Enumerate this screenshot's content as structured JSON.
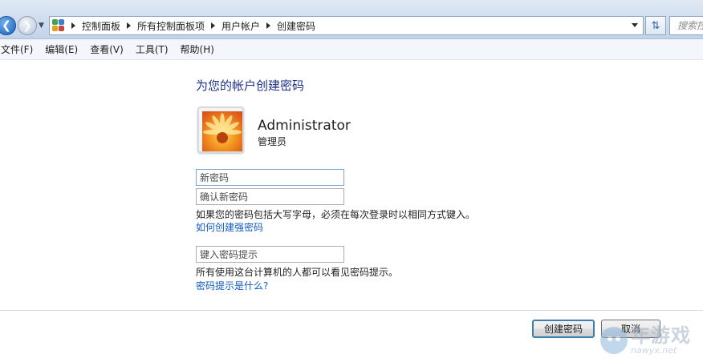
{
  "address_bar": {
    "breadcrumbs": [
      "控制面板",
      "所有控制面板项",
      "用户帐户",
      "创建密码"
    ],
    "search_placeholder": "搜索控"
  },
  "menu": {
    "items": [
      "文件(F)",
      "编辑(E)",
      "查看(V)",
      "工具(T)",
      "帮助(H)"
    ]
  },
  "main": {
    "title": "为您的帐户创建密码",
    "user": {
      "name": "Administrator",
      "role": "管理员"
    },
    "fields": {
      "new_password_placeholder": "新密码",
      "confirm_password_placeholder": "确认新密码",
      "hint_placeholder": "键入密码提示"
    },
    "caps_note": "如果您的密码包括大写字母，必须在每次登录时以相同方式键入。",
    "strong_password_link": "如何创建强密码",
    "hint_note": "所有使用这台计算机的人都可以看见密码提示。",
    "hint_link": "密码提示是什么?"
  },
  "buttons": {
    "create": "创建密码",
    "cancel": "取消"
  },
  "watermark": {
    "brand": "年游戏",
    "domain": "nawyx.net"
  },
  "colors": {
    "title": "#1e3287",
    "link": "#0f5bbd",
    "address_bar": "#cfdcee"
  }
}
